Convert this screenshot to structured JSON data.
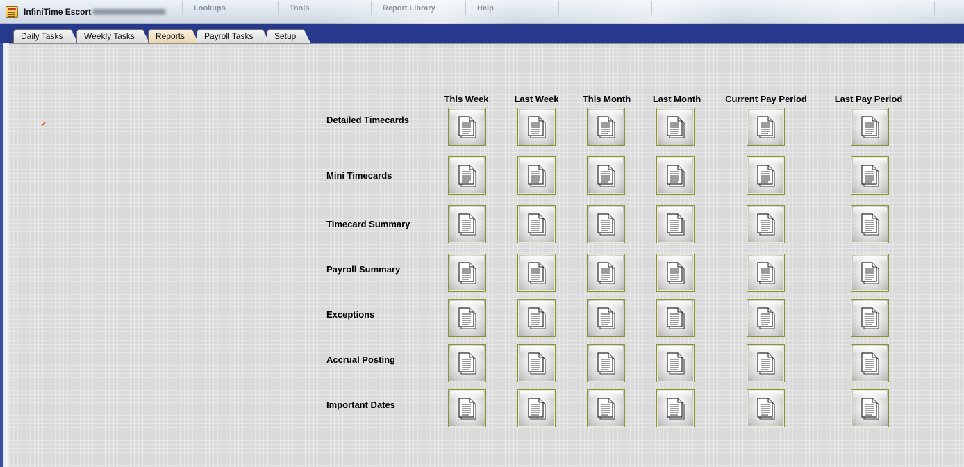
{
  "window": {
    "title": "InfiniTime Escort",
    "menu": [
      "Lookups",
      "Tools",
      "Report Library",
      "Help"
    ]
  },
  "tabs": [
    {
      "label": "Daily Tasks",
      "active": false
    },
    {
      "label": "Weekly Tasks",
      "active": false
    },
    {
      "label": "Reports",
      "active": true
    },
    {
      "label": "Payroll Tasks",
      "active": false
    },
    {
      "label": "Setup",
      "active": false
    }
  ],
  "reports": {
    "periods": [
      "This Week",
      "Last Week",
      "This Month",
      "Last Month",
      "Current Pay Period",
      "Last Pay Period"
    ],
    "rows": [
      "Detailed Timecards",
      "Mini Timecards",
      "Timecard Summary",
      "Payroll Summary",
      "Exceptions",
      "Accrual Posting",
      "Important Dates"
    ],
    "button_icon": "report-document-icon"
  },
  "colors": {
    "tab_strip": "#26398c",
    "active_tab": "#ecdcb9",
    "button_border": "#8d9230",
    "panel_background": "#dadada"
  }
}
